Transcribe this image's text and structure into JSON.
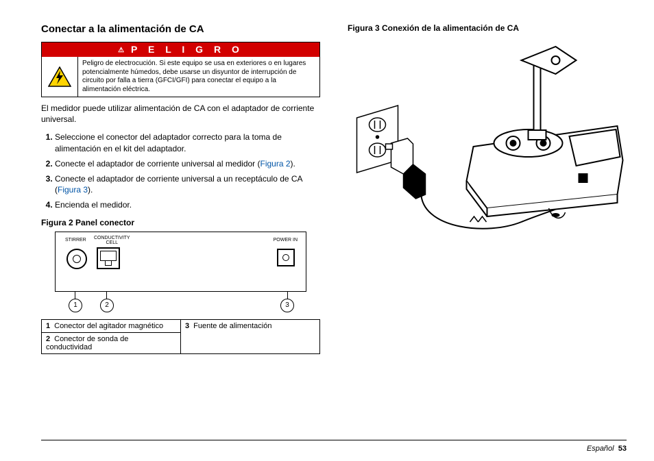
{
  "left": {
    "heading": "Conectar a la alimentación de CA",
    "danger": {
      "header": "P E L I G R O",
      "text": "Peligro de electrocución. Si este equipo se usa en exteriores o en lugares potencialmente húmedos, debe usarse un disyuntor de interrupción de circuito por falla a tierra (GFCI/GFI) para conectar el equipo a la alimentación eléctrica."
    },
    "intro": "El medidor puede utilizar alimentación de CA con el adaptador de corriente universal.",
    "steps": {
      "s1": "Seleccione el conector del adaptador correcto para la toma de alimentación en el kit del adaptador.",
      "s2a": "Conecte el adaptador de corriente universal al medidor (",
      "s2link": "Figura 2",
      "s2b": ").",
      "s3a": "Conecte el adaptador de corriente universal a un receptáculo de CA (",
      "s3link": "Figura 3",
      "s3b": ").",
      "s4": "Encienda el medidor."
    },
    "fig2caption": "Figura 2  Panel conector",
    "panel": {
      "stirrer": "STIRRER",
      "cond": "CONDUCTIVITY\nCELL",
      "power": "POWER IN",
      "c1": "1",
      "c2": "2",
      "c3": "3"
    },
    "legend": {
      "r1n": "1",
      "r1t": "Conector del agitador magnético",
      "r2n": "2",
      "r2t": "Conector de sonda de conductividad",
      "r3n": "3",
      "r3t": "Fuente de alimentación"
    }
  },
  "right": {
    "fig3caption": "Figura 3  Conexión de la alimentación de CA"
  },
  "footer": {
    "lang": "Español",
    "page": "53"
  }
}
